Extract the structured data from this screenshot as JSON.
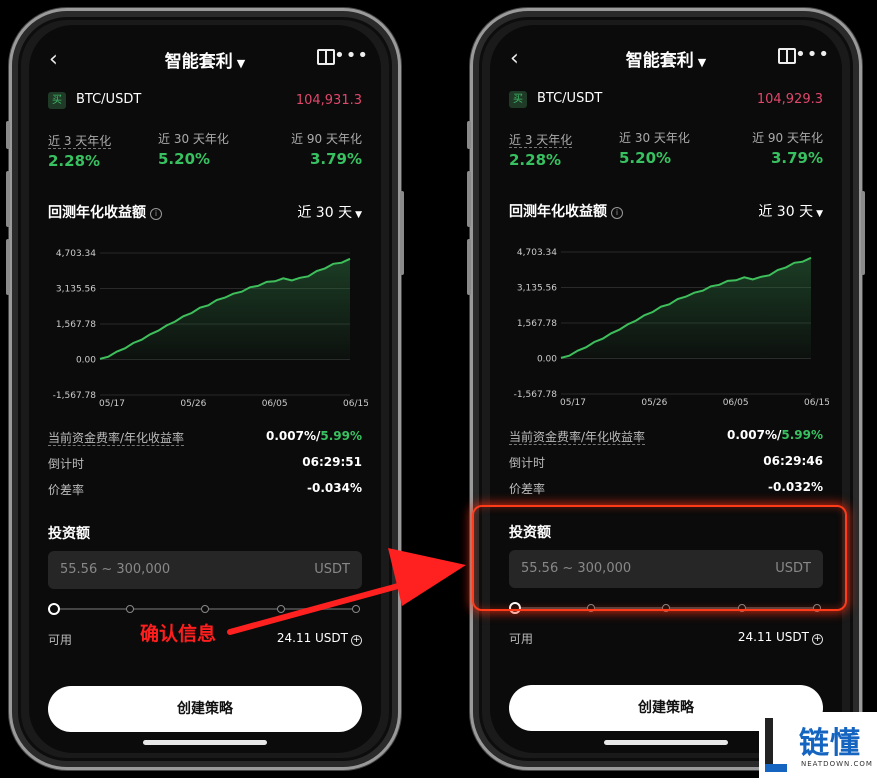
{
  "phones": [
    {
      "nav": {
        "title": "智能套利"
      },
      "pair": {
        "side_badge": "买",
        "symbol": "BTC/USDT",
        "price": "104,931.3"
      },
      "stats": [
        {
          "label": "近 3 天年化",
          "value": "2.28%"
        },
        {
          "label": "近 30 天年化",
          "value": "5.20%"
        },
        {
          "label": "近 90 天年化",
          "value": "3.79%"
        }
      ],
      "chart_title": "回测年化收益额",
      "range": "近 30 天",
      "rows": {
        "funding_label": "当前资金费率/年化收益率",
        "funding_value": "0.007%/",
        "funding_apr": "5.99%",
        "countdown_label": "倒计时",
        "countdown_value": "06:29:51",
        "spread_label": "价差率",
        "spread_value": "-0.034%"
      },
      "invest": {
        "label": "投资额",
        "placeholder": "55.56 ~ 300,000",
        "unit": "USDT"
      },
      "avail": {
        "label": "可用",
        "value": "24.11 USDT"
      },
      "cta": "创建策略"
    },
    {
      "nav": {
        "title": "智能套利"
      },
      "pair": {
        "side_badge": "买",
        "symbol": "BTC/USDT",
        "price": "104,929.3"
      },
      "stats": [
        {
          "label": "近 3 天年化",
          "value": "2.28%"
        },
        {
          "label": "近 30 天年化",
          "value": "5.20%"
        },
        {
          "label": "近 90 天年化",
          "value": "3.79%"
        }
      ],
      "chart_title": "回测年化收益额",
      "range": "近 30 天",
      "rows": {
        "funding_label": "当前资金费率/年化收益率",
        "funding_value": "0.007%/",
        "funding_apr": "5.99%",
        "countdown_label": "倒计时",
        "countdown_value": "06:29:46",
        "spread_label": "价差率",
        "spread_value": "-0.032%"
      },
      "invest": {
        "label": "投资额",
        "placeholder": "55.56 ~ 300,000",
        "unit": "USDT"
      },
      "avail": {
        "label": "可用",
        "value": "24.11 USDT"
      },
      "cta": "创建策略"
    }
  ],
  "chart_data": {
    "type": "area",
    "x_ticks": [
      "05/17",
      "05/26",
      "06/05",
      "06/15"
    ],
    "y_ticks": [
      "4,703.34",
      "3,135.56",
      "1,567.78",
      "0.00",
      "-1,567.78"
    ],
    "ylim": [
      -1567.78,
      4703.34
    ],
    "series": [
      {
        "values": [
          0,
          150,
          320,
          520,
          700,
          900,
          1080,
          1300,
          1480,
          1700,
          1880,
          2080,
          2260,
          2420,
          2600,
          2760,
          2880,
          3020,
          3160,
          3280,
          3400,
          3480,
          3560,
          3520,
          3580,
          3700,
          3880,
          4050,
          4200,
          4300,
          4420
        ]
      }
    ],
    "line_color": "#3fbf5c"
  },
  "annotation": "确认信息",
  "logo": {
    "cn": "链懂",
    "en": "NEATDOWN.COM"
  }
}
